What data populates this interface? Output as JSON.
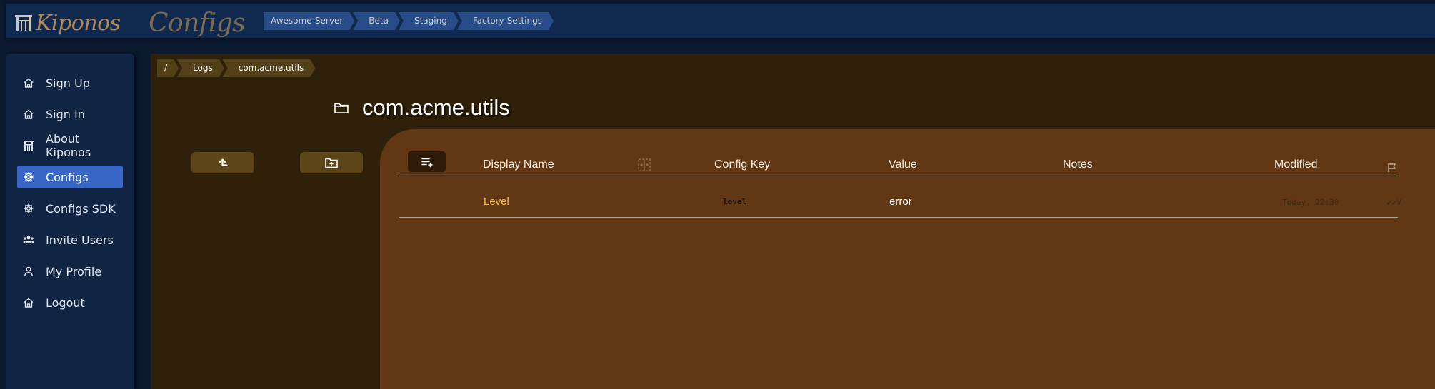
{
  "app": {
    "logo_text": "Kiponos",
    "page_title": "Configs"
  },
  "environment_breadcrumb": [
    "Awesome-Server",
    "Beta",
    "Staging",
    "Factory-Settings"
  ],
  "sidebar": {
    "items": [
      {
        "label": "Sign Up",
        "icon": "home-icon",
        "active": false
      },
      {
        "label": "Sign In",
        "icon": "home-icon",
        "active": false
      },
      {
        "label": "About Kiponos",
        "icon": "kiponos-logo-icon",
        "active": false
      },
      {
        "label": "Configs",
        "icon": "gear-icon",
        "active": true
      },
      {
        "label": "Configs SDK",
        "icon": "gear-icon",
        "active": false
      },
      {
        "label": "Invite Users",
        "icon": "users-icon",
        "active": false
      },
      {
        "label": "My Profile",
        "icon": "user-icon",
        "active": false
      },
      {
        "label": "Logout",
        "icon": "home-icon",
        "active": false
      }
    ]
  },
  "path_breadcrumb": [
    "/",
    "Logs",
    "com.acme.utils"
  ],
  "folder": {
    "icon": "folder-icon",
    "name": "com.acme.utils"
  },
  "actions": {
    "up_icon": "arrow-up-left-icon",
    "new_folder_icon": "folder-plus-icon",
    "add_config_icon": "playlist-add-icon"
  },
  "table": {
    "columns": {
      "display_name": "Display Name",
      "config_key": "Config Key",
      "value": "Value",
      "notes": "Notes",
      "modified": "Modified"
    },
    "expand_icon": "expand-columns-icon",
    "flag_icon": "flag-icon",
    "rows": [
      {
        "display_name": "Level",
        "config_key": "level",
        "value": "error",
        "notes": "",
        "flag": "✔✔V",
        "modified": "Today, 22:30"
      }
    ]
  },
  "colors": {
    "topbar": "#102a4f",
    "sidebar": "#102443",
    "active_nav": "#3766c6",
    "main_bg": "#2f2109",
    "panel_bg": "#623814",
    "accent_name": "#f2c13a"
  }
}
